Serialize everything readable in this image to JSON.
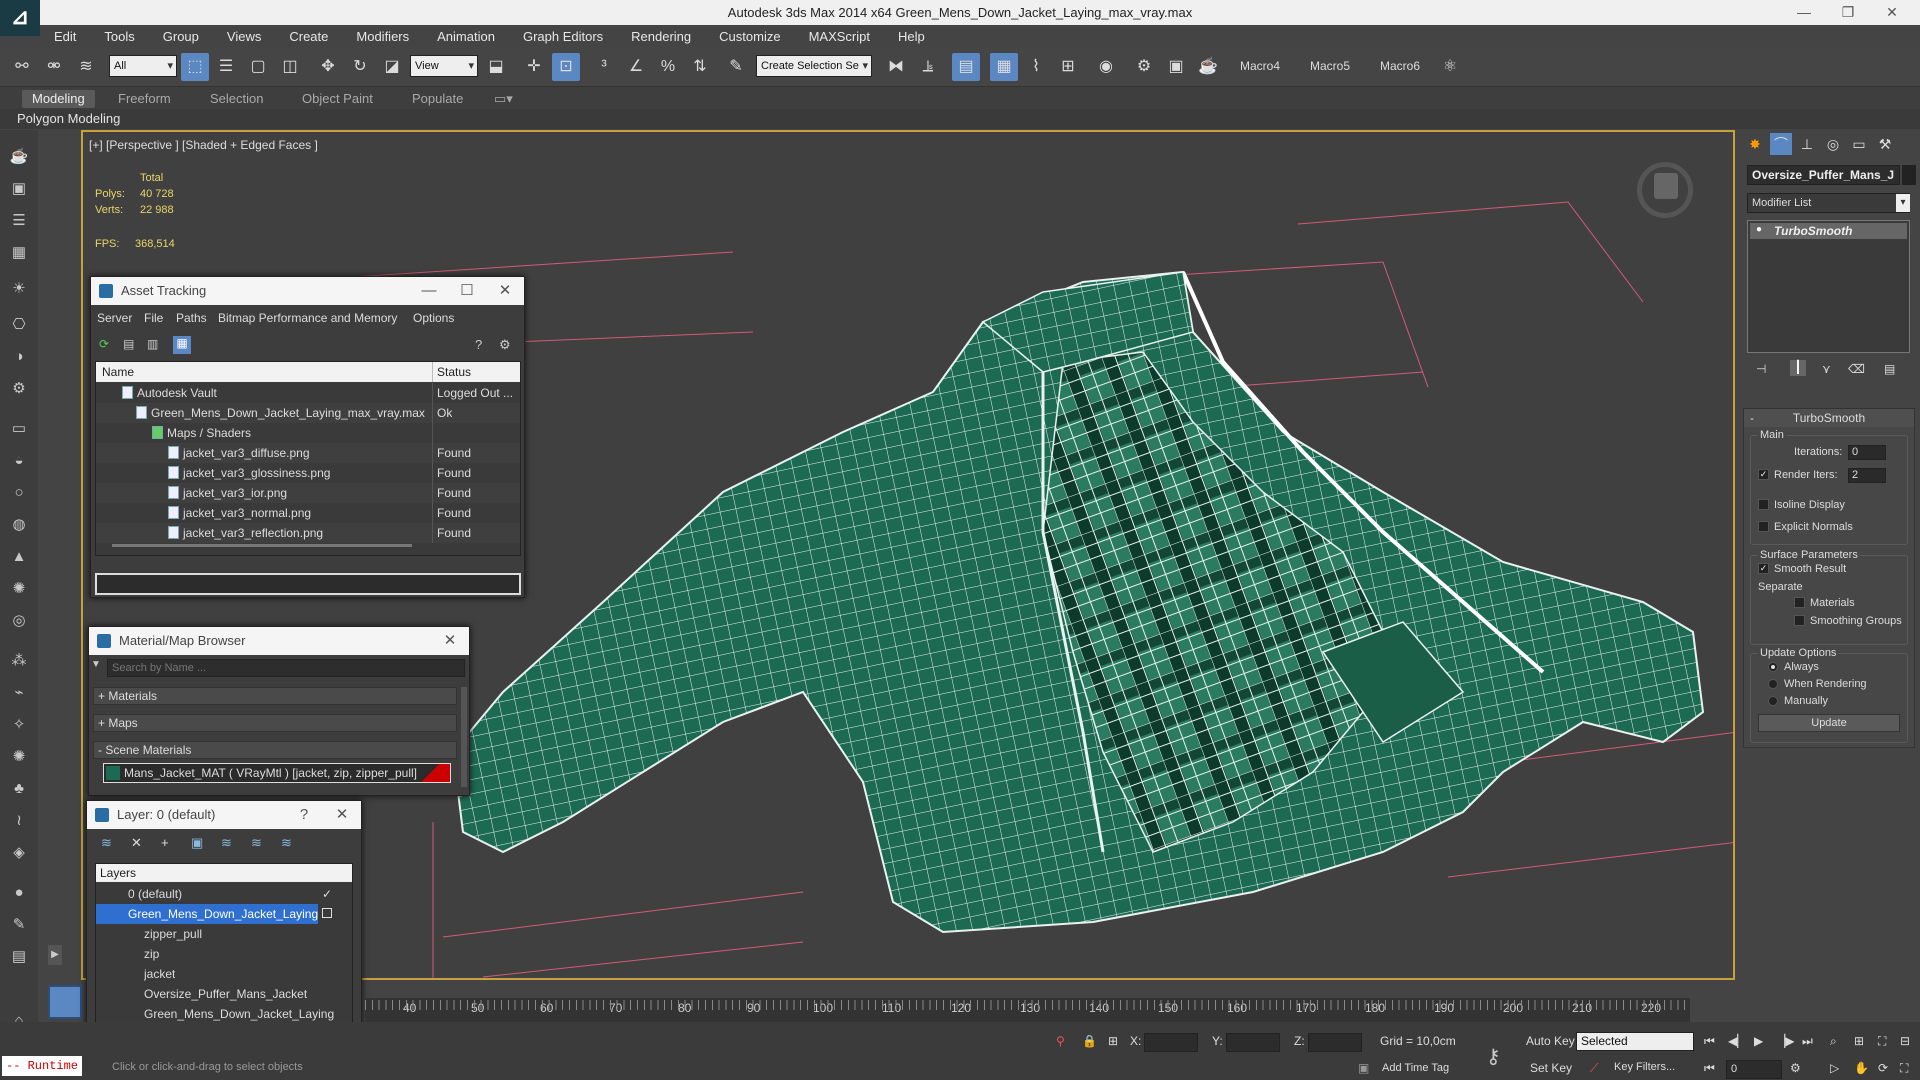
{
  "window": {
    "title": "Autodesk 3ds Max  2014 x64     Green_Mens_Down_Jacket_Laying_max_vray.max"
  },
  "menu": [
    "Edit",
    "Tools",
    "Group",
    "Views",
    "Create",
    "Modifiers",
    "Animation",
    "Graph Editors",
    "Rendering",
    "Customize",
    "MAXScript",
    "Help"
  ],
  "toolbar": {
    "filter_value": "All",
    "refcoord_value": "View",
    "selection_set_placeholder": "Create Selection Se",
    "macros": [
      "Macro4",
      "Macro5",
      "Macro6"
    ]
  },
  "ribbon": {
    "tabs": [
      "Modeling",
      "Freeform",
      "Selection",
      "Object Paint",
      "Populate"
    ],
    "active": "Modeling",
    "sub_label": "Polygon Modeling"
  },
  "viewport": {
    "label": "[+] [Perspective ] [Shaded + Edged Faces ]",
    "stats": {
      "header": "Total",
      "polys_label": "Polys:",
      "polys": "40 728",
      "verts_label": "Verts:",
      "verts": "22 988",
      "fps_label": "FPS:",
      "fps": "368,514"
    }
  },
  "asset_tracking": {
    "title": "Asset Tracking",
    "menu": [
      "Server",
      "File",
      "Paths",
      "Bitmap Performance and Memory",
      "Options"
    ],
    "columns": [
      "Name",
      "Status"
    ],
    "rows": [
      {
        "name": "Autodesk Vault",
        "status": "Logged Out ..."
      },
      {
        "name": "Green_Mens_Down_Jacket_Laying_max_vray.max",
        "status": "Ok"
      },
      {
        "name": "Maps / Shaders",
        "status": ""
      },
      {
        "name": "jacket_var3_diffuse.png",
        "status": "Found"
      },
      {
        "name": "jacket_var3_glossiness.png",
        "status": "Found"
      },
      {
        "name": "jacket_var3_ior.png",
        "status": "Found"
      },
      {
        "name": "jacket_var3_normal.png",
        "status": "Found"
      },
      {
        "name": "jacket_var3_reflection.png",
        "status": "Found"
      }
    ]
  },
  "material_browser": {
    "title": "Material/Map Browser",
    "search_placeholder": "Search by Name ...",
    "sections": [
      "+ Materials",
      "+ Maps",
      "- Scene Materials"
    ],
    "scene_material": "Mans_Jacket_MAT  ( VRayMtl ) [jacket, zip, zipper_pull]"
  },
  "layer_explorer": {
    "title": "Layer: 0 (default)",
    "header": "Layers",
    "rows": [
      "0 (default)",
      "Green_Mens_Down_Jacket_Laying",
      "zipper_pull",
      "zip",
      "jacket",
      "Oversize_Puffer_Mans_Jacket",
      "Green_Mens_Down_Jacket_Laying"
    ]
  },
  "command_panel": {
    "object_name": "Oversize_Puffer_Mans_J",
    "modifier_list": "Modifier List",
    "stack_item": "TurboSmooth",
    "rollout_title": "TurboSmooth",
    "main_label": "Main",
    "iterations_label": "Iterations:",
    "iterations": "0",
    "render_iters_label": "Render Iters:",
    "render_iters": "2",
    "isoline": "Isoline Display",
    "explicit_normals": "Explicit Normals",
    "surface_params": "Surface Parameters",
    "smooth_result": "Smooth Result",
    "separate": "Separate",
    "materials": "Materials",
    "smoothing_groups": "Smoothing Groups",
    "update_options": "Update Options",
    "always": "Always",
    "when_rendering": "When Rendering",
    "manually": "Manually",
    "update_button": "Update"
  },
  "timeline": {
    "ticks": [
      "40",
      "50",
      "60",
      "70",
      "80",
      "90",
      "100",
      "110",
      "120",
      "130",
      "140",
      "150",
      "160",
      "170",
      "180",
      "190",
      "200",
      "210",
      "220"
    ]
  },
  "statusbar": {
    "runtime": "-- Runtime",
    "prompt": "Click or click-and-drag to select objects",
    "x_label": "X:",
    "y_label": "Y:",
    "z_label": "Z:",
    "grid": "Grid = 10,0cm",
    "add_time_tag": "Add Time Tag",
    "auto_key": "Auto Key",
    "set_key": "Set Key",
    "selected": "Selected",
    "key_filters": "Key Filters...",
    "frame": "0"
  },
  "colors": {
    "accent": "#5b87c2",
    "viewport_border": "#c9a13a",
    "jacket": "#1d6a52",
    "wire": "#e8f2ee"
  }
}
